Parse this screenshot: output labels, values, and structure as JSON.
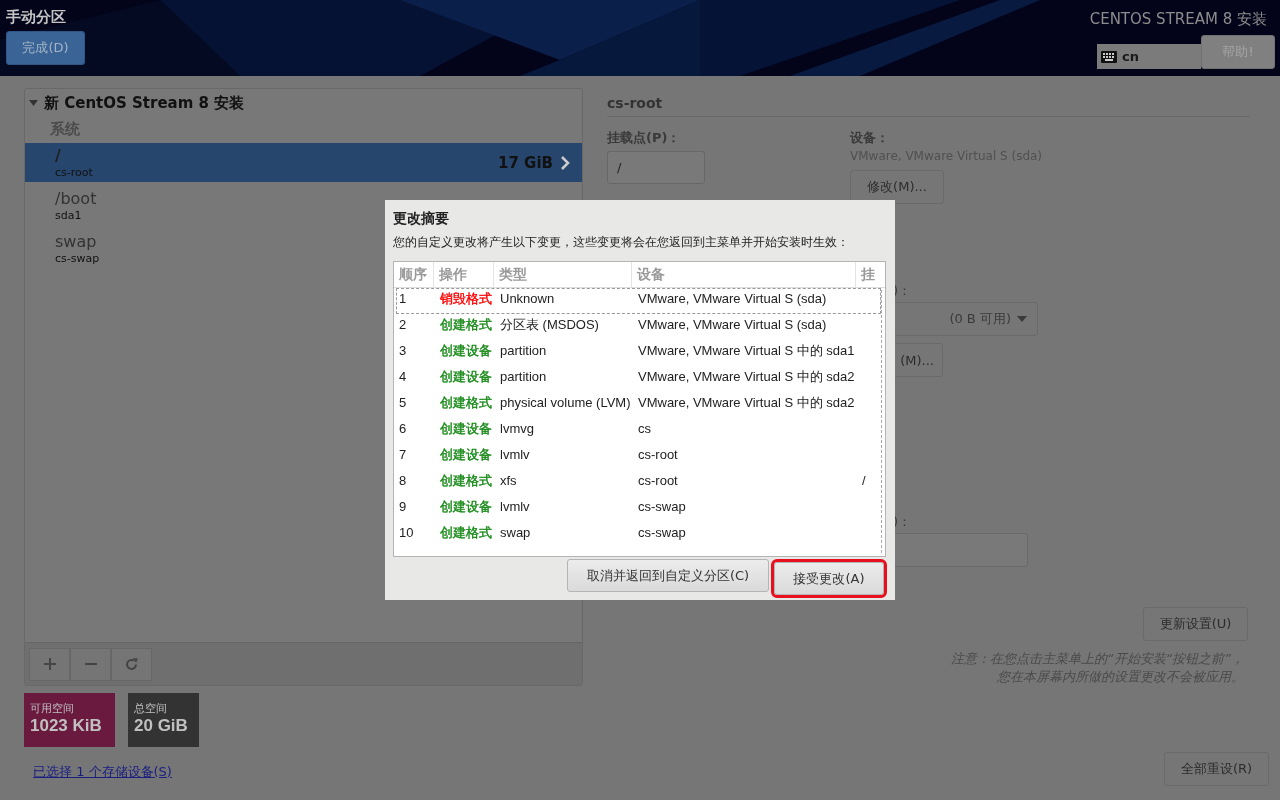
{
  "header": {
    "title": "手动分区",
    "done_button": "完成(D)",
    "product": "CENTOS STREAM 8 安装",
    "keyboard_layout": "cn",
    "help_button": "帮助!"
  },
  "partitions": {
    "tree": {
      "label": "新 CentOS Stream 8 安装",
      "expanded": true,
      "children": [
        {
          "label": "系统",
          "children": [
            {
              "mount": "/",
              "device": "cs-root",
              "size": "17 GiB",
              "selected": true
            },
            {
              "mount": "/boot",
              "device": "sda1",
              "selected": false
            },
            {
              "mount": "swap",
              "device": "cs-swap",
              "selected": false
            }
          ]
        }
      ]
    },
    "available_space": {
      "label": "可用空间",
      "value": "1023 KiB"
    },
    "total_space": {
      "label": "总空间",
      "value": "20 GiB"
    },
    "storage_link": "已选择 1 个存储设备(S)"
  },
  "details": {
    "name": "cs-root",
    "mount_label": "挂载点(P)：",
    "mount_value": "/",
    "device_label": "设备：",
    "device_value": "VMware, VMware Virtual S (sda)",
    "modify_button": "修改(M)...",
    "partial_groups": [
      [
        {
          "kind": "label",
          "text": ")："
        },
        {
          "kind": "dropdown",
          "text": "(0 B 可用)"
        },
        {
          "kind": "button",
          "text": "(M)..."
        }
      ],
      [
        {
          "kind": "label",
          "text": ")："
        },
        {
          "kind": "input"
        }
      ]
    ],
    "update_button": "更新设置(U)",
    "note": [
      "注意：在您点击主菜单上的“开始安装“按钮之前”，",
      "您在本屏幕内所做的设置更改不会被应用。"
    ],
    "reset_button": "全部重设(R)"
  },
  "dialog": {
    "title": "更改摘要",
    "description": "您的自定义更改将产生以下变更，这些变更将会在您返回到主菜单并开始安装时生效：",
    "columns": [
      "顺序",
      "操作",
      "类型",
      "设备",
      "挂"
    ],
    "rows": [
      {
        "order": "1",
        "action": "销毁格式",
        "color": "#ff0000",
        "type": "Unknown",
        "device": "VMware, VMware Virtual S (sda)",
        "focused": true
      },
      {
        "order": "2",
        "action": "创建格式",
        "color": "#188a18",
        "type": "分区表 (MSDOS)",
        "device": "VMware, VMware Virtual S (sda)",
        "focused": false
      },
      {
        "order": "3",
        "action": "创建设备",
        "color": "#188a18",
        "type": "partition",
        "device": "VMware, VMware Virtual S 中的 sda1",
        "focused": false
      },
      {
        "order": "4",
        "action": "创建设备",
        "color": "#188a18",
        "type": "partition",
        "device": "VMware, VMware Virtual S 中的 sda2",
        "focused": false
      },
      {
        "order": "5",
        "action": "创建格式",
        "color": "#188a18",
        "type": "physical volume (LVM)",
        "device": "VMware, VMware Virtual S 中的 sda2",
        "focused": false
      },
      {
        "order": "6",
        "action": "创建设备",
        "color": "#188a18",
        "type": "lvmvg",
        "device": "cs",
        "focused": false
      },
      {
        "order": "7",
        "action": "创建设备",
        "color": "#188a18",
        "type": "lvmlv",
        "device": "cs-root",
        "focused": false
      },
      {
        "order": "8",
        "action": "创建格式",
        "color": "#188a18",
        "type": "xfs",
        "device": "cs-root",
        "mount": "/",
        "focused": false
      },
      {
        "order": "9",
        "action": "创建设备",
        "color": "#188a18",
        "type": "lvmlv",
        "device": "cs-swap",
        "focused": false
      },
      {
        "order": "10",
        "action": "创建格式",
        "color": "#188a18",
        "type": "swap",
        "device": "cs-swap",
        "focused": false
      }
    ],
    "buttons": [
      {
        "label": "取消并返回到自定义分区(C)",
        "highlighted": false
      },
      {
        "label": "接受更改(A)",
        "highlighted": true
      }
    ]
  }
}
